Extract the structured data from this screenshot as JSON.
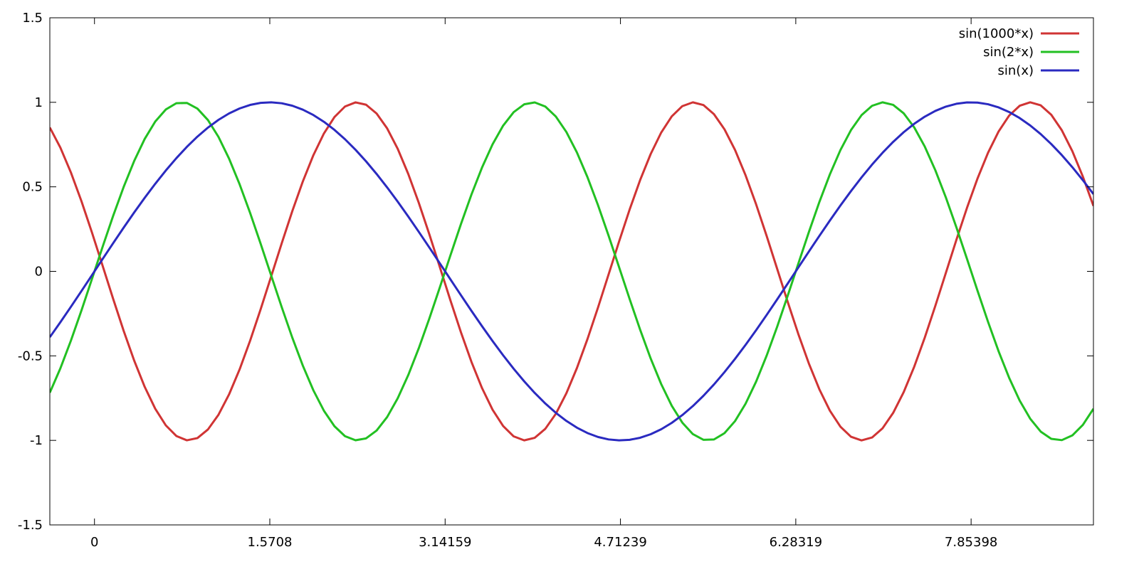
{
  "chart_data": {
    "type": "line",
    "title": "",
    "xlabel": "",
    "ylabel": "",
    "xlim": [
      -0.4,
      8.95
    ],
    "ylim": [
      -1.5,
      1.5
    ],
    "x_ticks": [
      {
        "value": 0,
        "label": "0"
      },
      {
        "value": 1.5708,
        "label": "1.5708"
      },
      {
        "value": 3.14159,
        "label": "3.14159"
      },
      {
        "value": 4.71239,
        "label": "4.71239"
      },
      {
        "value": 6.28319,
        "label": "6.28319"
      },
      {
        "value": 7.85398,
        "label": "7.85398"
      }
    ],
    "y_ticks": [
      {
        "value": 1.5,
        "label": "1.5"
      },
      {
        "value": 1,
        "label": "1"
      },
      {
        "value": 0.5,
        "label": "0.5"
      },
      {
        "value": 0,
        "label": "0"
      },
      {
        "value": -0.5,
        "label": "-0.5"
      },
      {
        "value": -1,
        "label": "-1"
      },
      {
        "value": -1.5,
        "label": "-1.5"
      }
    ],
    "grid": false,
    "legend_position": "top-right",
    "series": [
      {
        "name": "sin(1000*x)",
        "function": "sin(1000*x)",
        "frequency": 1000,
        "color": "#d03434",
        "samples": 100
      },
      {
        "name": "sin(2*x)",
        "function": "sin(2*x)",
        "frequency": 2,
        "color": "#22c022",
        "samples": 100
      },
      {
        "name": "sin(x)",
        "function": "sin(x)",
        "frequency": 1,
        "color": "#2a2ac0",
        "samples": 100
      }
    ]
  }
}
